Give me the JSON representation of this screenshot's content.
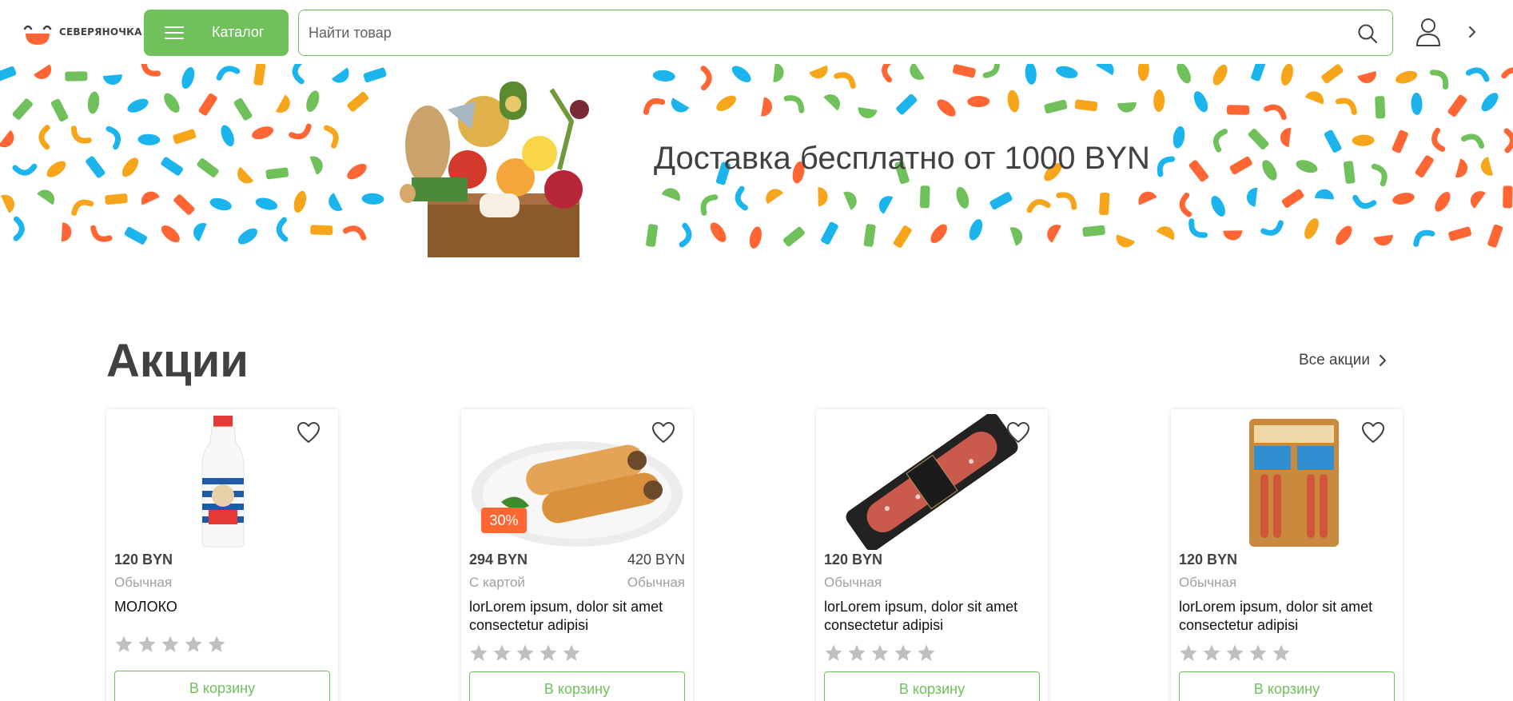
{
  "header": {
    "logo_text": "СЕВЕРЯНОЧКА",
    "catalog_label": "Каталог",
    "search_placeholder": "Найти товар"
  },
  "banner": {
    "title": "Доставка бесплатно от 1000 BYN"
  },
  "promo": {
    "title": "Акции",
    "all_link": "Все акции"
  },
  "colors": {
    "accent_green": "#70c05b",
    "accent_orange": "#ff6633",
    "text_main": "#414141",
    "text_muted": "#a0a0a0"
  },
  "products": [
    {
      "image": "milk-bottle",
      "price": "120 BYN",
      "price_label": "Обычная",
      "name": "МОЛОКО",
      "rating": 0,
      "cart_label": "В корзину"
    },
    {
      "image": "pancakes-plate",
      "discount": "30%",
      "price": "294 BYN",
      "price_label": "С картой",
      "old_price": "420 BYN",
      "old_price_label": "Обычная",
      "name": "lorLorem ipsum, dolor sit amet consectetur adipisi",
      "rating": 0,
      "cart_label": "В корзину"
    },
    {
      "image": "sausage-pack",
      "price": "120 BYN",
      "price_label": "Обычная",
      "name": "lorLorem ipsum, dolor sit amet consectetur adipisi",
      "rating": 0,
      "cart_label": "В корзину"
    },
    {
      "image": "sausages-box",
      "price": "120 BYN",
      "price_label": "Обычная",
      "name": "lorLorem ipsum, dolor sit amet consectetur adipisi",
      "rating": 0,
      "cart_label": "В корзину"
    }
  ]
}
